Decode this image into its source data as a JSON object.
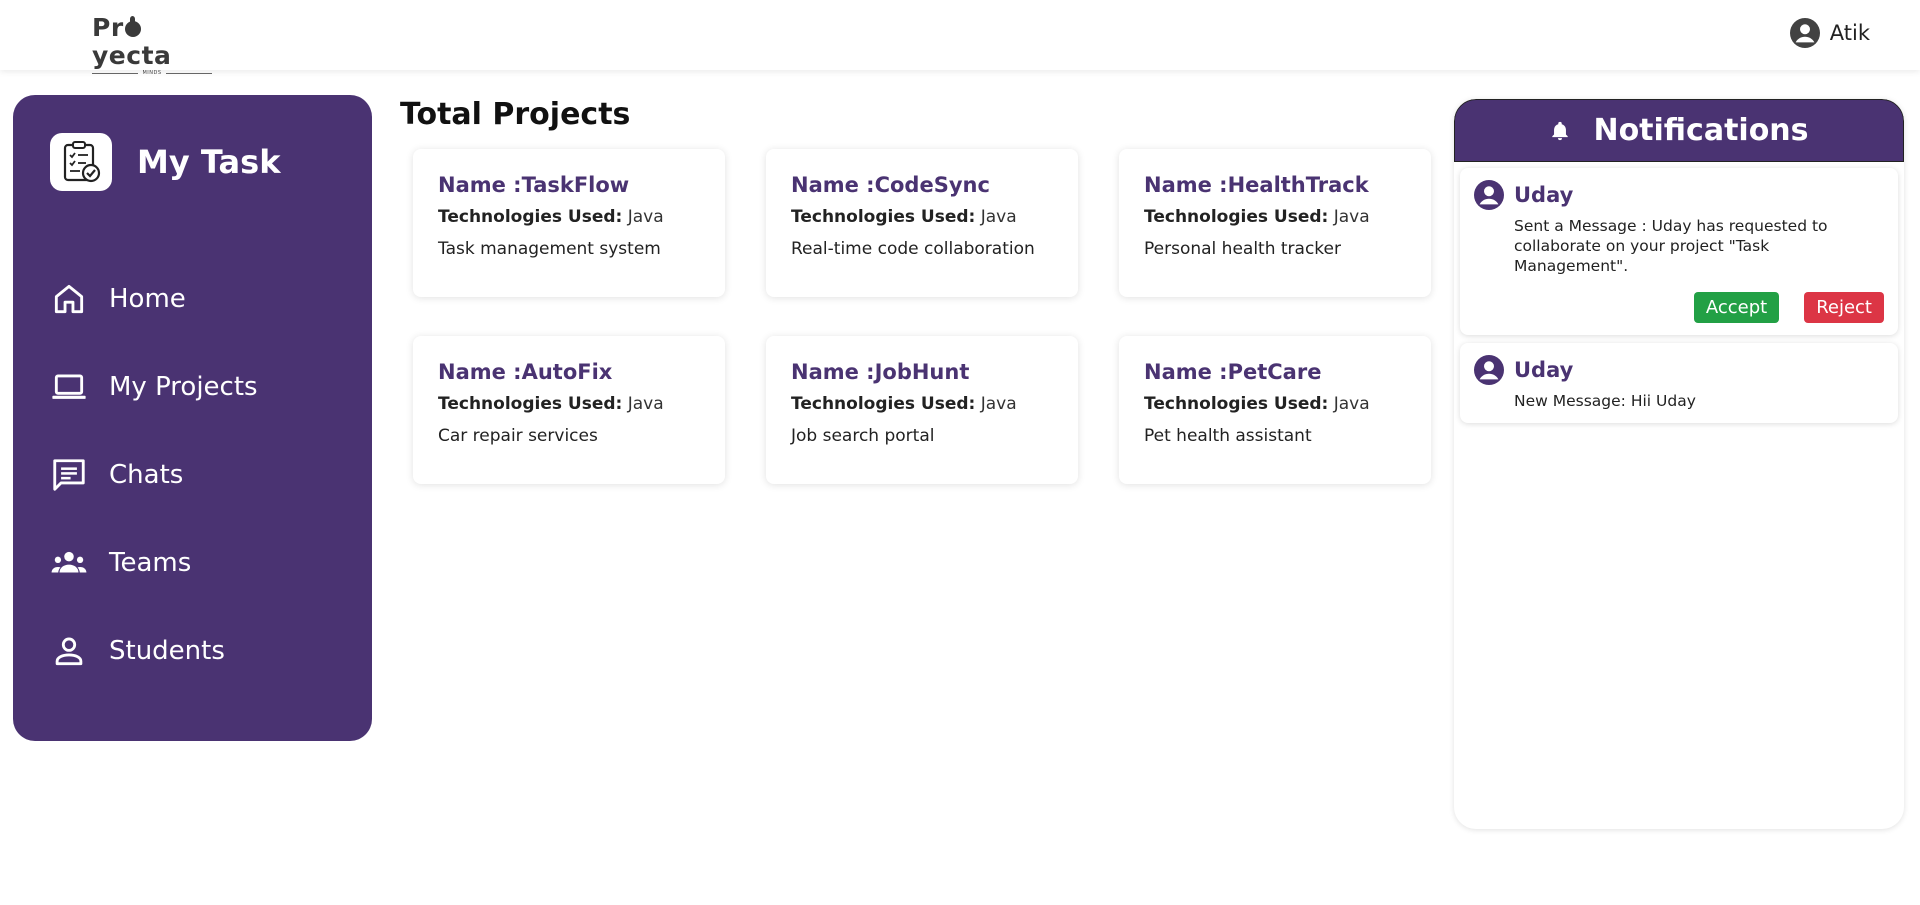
{
  "header": {
    "logo_text_1": "Pr",
    "logo_text_2": "yecta",
    "logo_sub": "MINDS",
    "user_name": "Atik"
  },
  "sidebar": {
    "brand_title": "My Task",
    "items": [
      {
        "label": "Home",
        "icon": "home-icon"
      },
      {
        "label": "My Projects",
        "icon": "laptop-icon"
      },
      {
        "label": "Chats",
        "icon": "chat-icon"
      },
      {
        "label": "Teams",
        "icon": "team-icon"
      },
      {
        "label": "Students",
        "icon": "person-icon"
      }
    ]
  },
  "main": {
    "title": "Total Projects",
    "tech_label": "Technologies Used:",
    "projects": [
      {
        "name": "Name :TaskFlow",
        "tech": "Java",
        "desc": "Task management system"
      },
      {
        "name": "Name :CodeSync",
        "tech": "Java",
        "desc": "Real-time code collaboration"
      },
      {
        "name": "Name :HealthTrack",
        "tech": "Java",
        "desc": "Personal health tracker"
      },
      {
        "name": "Name :AutoFix",
        "tech": "Java",
        "desc": "Car repair services"
      },
      {
        "name": "Name :JobHunt",
        "tech": "Java",
        "desc": "Job search portal"
      },
      {
        "name": "Name :PetCare",
        "tech": "Java",
        "desc": "Pet health assistant"
      }
    ]
  },
  "notifications": {
    "title": "Notifications",
    "items": [
      {
        "name": "Uday",
        "message": "Sent a Message : Uday has requested to collaborate on your project \"Task Management\".",
        "accept_label": "Accept",
        "reject_label": "Reject"
      },
      {
        "name": "Uday",
        "message": "New Message: Hii Uday"
      }
    ]
  },
  "colors": {
    "primary": "#4a3372",
    "accept": "#22a045",
    "reject": "#dc3545"
  }
}
